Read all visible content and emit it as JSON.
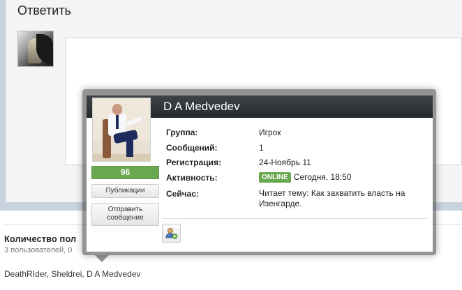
{
  "reply": {
    "title": "Ответить"
  },
  "stats": {
    "title": "Количество пол",
    "subtitle": "3 пользователей, 0",
    "users": [
      "DeathRIder",
      "Sheldrei",
      "D A Medvedev"
    ],
    "separator": ", "
  },
  "hovercard": {
    "name": "D A Medvedev",
    "reputation": "96",
    "buttons": {
      "publications": "Публикации",
      "send_message_line1": "Отправить",
      "send_message_line2": "сообщение"
    },
    "fields": {
      "group_label": "Группа:",
      "group_value": "Игрок",
      "posts_label": "Сообщений:",
      "posts_value": "1",
      "registration_label": "Регистрация:",
      "registration_value": "24-Ноябрь 11",
      "activity_label": "Активность:",
      "online_badge": "ONLINE",
      "activity_value": "Сегодня, 18:50",
      "now_label": "Сейчас:",
      "now_value": "Читает тему: Как захватить власть на Изенгарде."
    },
    "icons": {
      "add_friend": "add-friend-icon"
    },
    "colors": {
      "header": "#2b2f31",
      "reputation_green": "#6aa84f",
      "online_green": "#6aa84f"
    }
  }
}
